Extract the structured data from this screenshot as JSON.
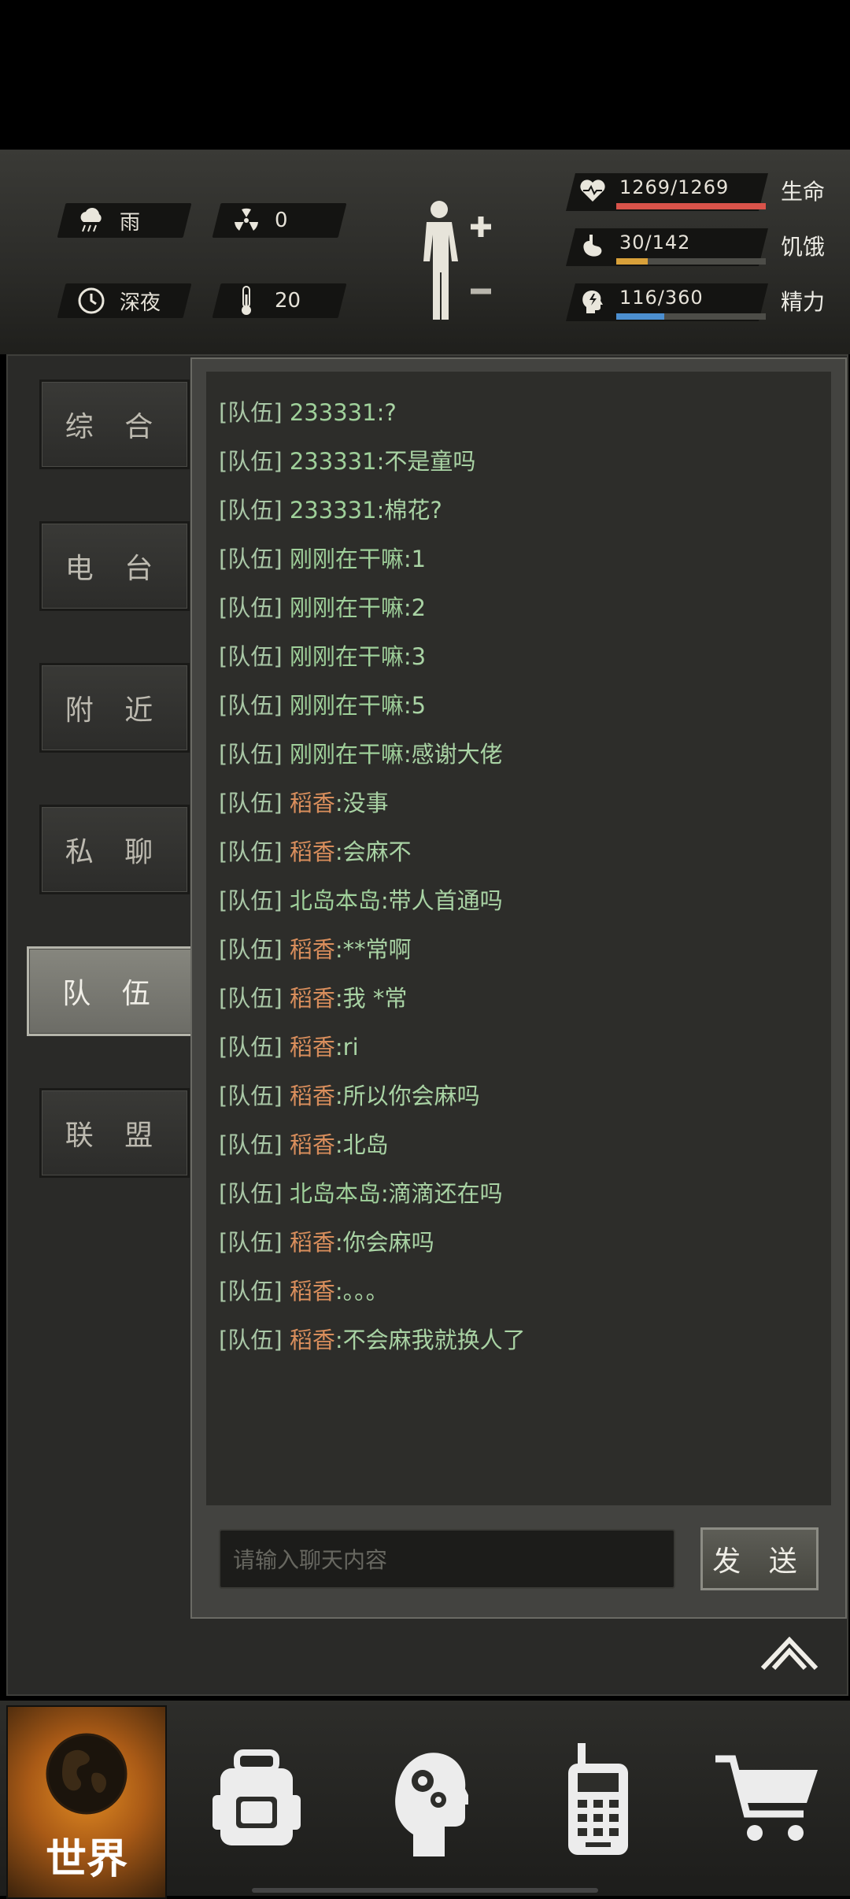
{
  "status": {
    "weather": {
      "icon": "rain-cloud-icon",
      "label": "雨"
    },
    "radiation": {
      "icon": "radiation-icon",
      "value": "0"
    },
    "time": {
      "icon": "clock-icon",
      "label": "深夜"
    },
    "temperature": {
      "icon": "thermometer-icon",
      "value": "20"
    }
  },
  "vitals": [
    {
      "icon": "heart-rate-icon",
      "value": "1269/1269",
      "label": "生命",
      "fraction": 1.0,
      "color": "#d9534a"
    },
    {
      "icon": "stomach-icon",
      "value": "30/142",
      "label": "饥饿",
      "fraction": 0.211,
      "color": "#d9a13a"
    },
    {
      "icon": "energy-head-icon",
      "value": "116/360",
      "label": "精力",
      "fraction": 0.322,
      "color": "#4c8fd0"
    }
  ],
  "tabs": [
    "综 合",
    "电 台",
    "附 近",
    "私 聊",
    "队 伍",
    "联 盟"
  ],
  "active_tab": "队 伍",
  "messages": [
    {
      "channel": "[队伍]",
      "name": "233331",
      "text": ":?",
      "name_color": "green"
    },
    {
      "channel": "[队伍]",
      "name": "233331",
      "text": ":不是童吗",
      "name_color": "green"
    },
    {
      "channel": "[队伍]",
      "name": "233331",
      "text": ":棉花?",
      "name_color": "green"
    },
    {
      "channel": "[队伍]",
      "name": "刚刚在干嘛",
      "text": ":1",
      "name_color": "green"
    },
    {
      "channel": "[队伍]",
      "name": "刚刚在干嘛",
      "text": ":2",
      "name_color": "green"
    },
    {
      "channel": "[队伍]",
      "name": "刚刚在干嘛",
      "text": ":3",
      "name_color": "green"
    },
    {
      "channel": "[队伍]",
      "name": "刚刚在干嘛",
      "text": ":5",
      "name_color": "green"
    },
    {
      "channel": "[队伍]",
      "name": "刚刚在干嘛",
      "text": ":感谢大佬",
      "name_color": "green"
    },
    {
      "channel": "[队伍]",
      "name": "稻香",
      "text": ":没事",
      "name_color": "orange"
    },
    {
      "channel": "[队伍]",
      "name": "稻香",
      "text": ":会麻不",
      "name_color": "orange"
    },
    {
      "channel": "[队伍]",
      "name": "北岛本岛",
      "text": ":带人首通吗",
      "name_color": "green"
    },
    {
      "channel": "[队伍]",
      "name": "稻香",
      "text": ":**常啊",
      "name_color": "orange"
    },
    {
      "channel": "[队伍]",
      "name": "稻香",
      "text": ":我 *常",
      "name_color": "orange"
    },
    {
      "channel": "[队伍]",
      "name": "稻香",
      "text": ":ri",
      "name_color": "orange"
    },
    {
      "channel": "[队伍]",
      "name": "稻香",
      "text": ":所以你会麻吗",
      "name_color": "orange"
    },
    {
      "channel": "[队伍]",
      "name": "稻香",
      "text": ":北岛",
      "name_color": "orange"
    },
    {
      "channel": "[队伍]",
      "name": "北岛本岛",
      "text": ":滴滴还在吗",
      "name_color": "green"
    },
    {
      "channel": "[队伍]",
      "name": "稻香",
      "text": ":你会麻吗",
      "name_color": "orange"
    },
    {
      "channel": "[队伍]",
      "name": "稻香",
      "text": ":。。。",
      "name_color": "orange"
    },
    {
      "channel": "[队伍]",
      "name": "稻香",
      "text": ":不会麻我就换人了",
      "name_color": "orange"
    }
  ],
  "input": {
    "placeholder": "请输入聊天内容"
  },
  "send_label": "发 送",
  "bottom_nav": [
    {
      "label": "世界",
      "icon": "globe-icon"
    },
    {
      "label": "",
      "icon": "backpack-icon"
    },
    {
      "label": "",
      "icon": "head-gears-icon"
    },
    {
      "label": "",
      "icon": "walkie-talkie-icon"
    },
    {
      "label": "",
      "icon": "shopping-cart-icon"
    }
  ]
}
